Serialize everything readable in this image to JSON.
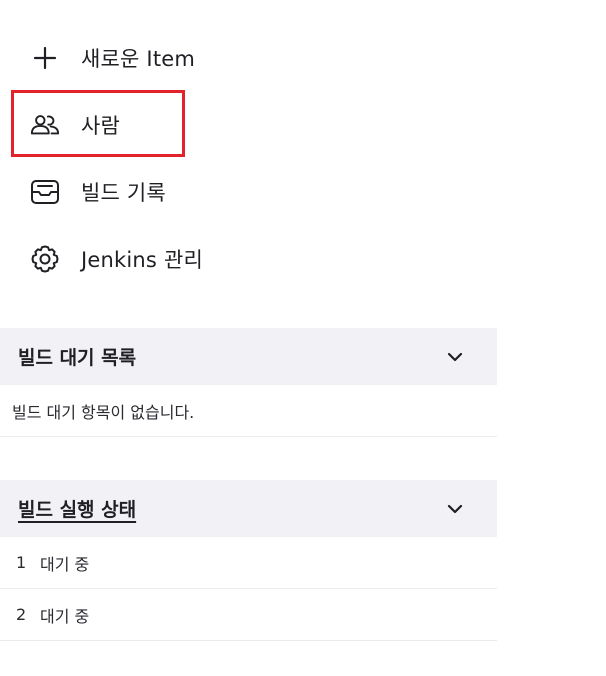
{
  "nav": {
    "items": [
      {
        "label": "새로운 Item",
        "icon": "plus-icon"
      },
      {
        "label": "사람",
        "icon": "people-icon"
      },
      {
        "label": "빌드 기록",
        "icon": "inbox-icon"
      },
      {
        "label": "Jenkins 관리",
        "icon": "gear-icon"
      }
    ]
  },
  "highlight_color": "#e3232b",
  "build_queue": {
    "title": "빌드 대기 목록",
    "empty_text": "빌드 대기 항목이 없습니다."
  },
  "executors": {
    "title": "빌드 실행 상태",
    "rows": [
      {
        "num": "1",
        "status": "대기 중"
      },
      {
        "num": "2",
        "status": "대기 중"
      }
    ]
  }
}
